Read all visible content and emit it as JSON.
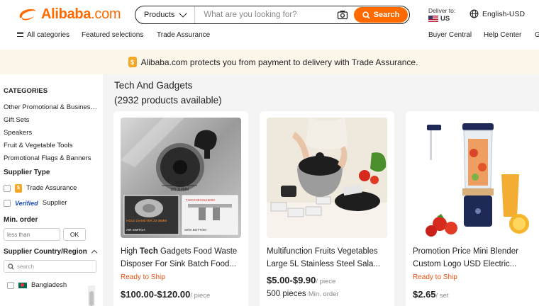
{
  "header": {
    "logo_text": "Alibaba",
    "logo_suffix": ".com",
    "search_category": "Products",
    "search_placeholder": "What are you looking for?",
    "search_button": "Search",
    "deliver_label": "Deliver to:",
    "deliver_country": "US",
    "language": "English-USD"
  },
  "subnav": {
    "all_categories": "All categories",
    "featured": "Featured selections",
    "trade_assurance": "Trade Assurance",
    "buyer_central": "Buyer Central",
    "help_center": "Help Center",
    "overflow": "G"
  },
  "banner": {
    "badge": "$",
    "text": "Alibaba.com protects you from payment to delivery with Trade Assurance."
  },
  "sidebar": {
    "categories_title": "CATEGORIES",
    "categories": [
      "Other Promotional & Business Gifts",
      "Gift Sets",
      "Speakers",
      "Fruit & Vegetable Tools",
      "Promotional Flags & Banners"
    ],
    "supplier_type_title": "Supplier Type",
    "trade_assurance_label": "Trade Assurance",
    "verified_badge": "Verified",
    "verified_label": "Supplier",
    "min_order_title": "Min. order",
    "min_order_placeholder": "less than",
    "ok_button": "OK",
    "region_title": "Supplier Country/Region",
    "region_search_placeholder": "search",
    "regions": [
      "Bangladesh"
    ]
  },
  "main": {
    "title": "Tech And Gadgets",
    "count": "(2932 products available)"
  },
  "products": [
    {
      "title_prefix": "High ",
      "title_bold": "Tech",
      "title_rest": " Gadgets Food Waste Disposer For Sink Batch Food...",
      "ready": "Ready to Ship",
      "price": "$100.00-$120.00",
      "unit": "/ piece",
      "moq": "",
      "moq_label": "",
      "image_labels": {
        "left_caption": "AIR SWITCH",
        "right_caption": "SINK BOTTOM",
        "hole_label": "HOLE DIAMETER:33-38MM",
        "thickness_label": "THICKNESS≤15MM",
        "dim_top": "90MM",
        "dim_bottom": "100-114MM"
      }
    },
    {
      "title_prefix": "",
      "title_bold": "",
      "title_rest": "Multifunction Fruits Vegetables Large 5L Stainless Steel Sala...",
      "ready": "",
      "price": "$5.00-$9.90",
      "unit": "/ piece",
      "moq": "500 pieces",
      "moq_label": "Min. order"
    },
    {
      "title_prefix": "",
      "title_bold": "",
      "title_rest": "Promotion Price Mini Blender Custom Logo USD Electric...",
      "ready": "Ready to Ship",
      "price": "$2.65",
      "unit": "/ set",
      "moq": "",
      "moq_label": ""
    }
  ],
  "colors": {
    "brand": "#ff6a00",
    "ready_to_ship": "#e8530e",
    "banner_bg": "#fdf6ea",
    "main_bg": "#f4f4f4"
  },
  "icons": [
    "alibaba-logo-icon",
    "chevron-down-icon",
    "camera-icon",
    "search-icon",
    "us-flag-icon",
    "globe-icon",
    "menu-icon",
    "trade-assurance-icon",
    "chevron-up-icon",
    "bangladesh-flag-icon"
  ]
}
